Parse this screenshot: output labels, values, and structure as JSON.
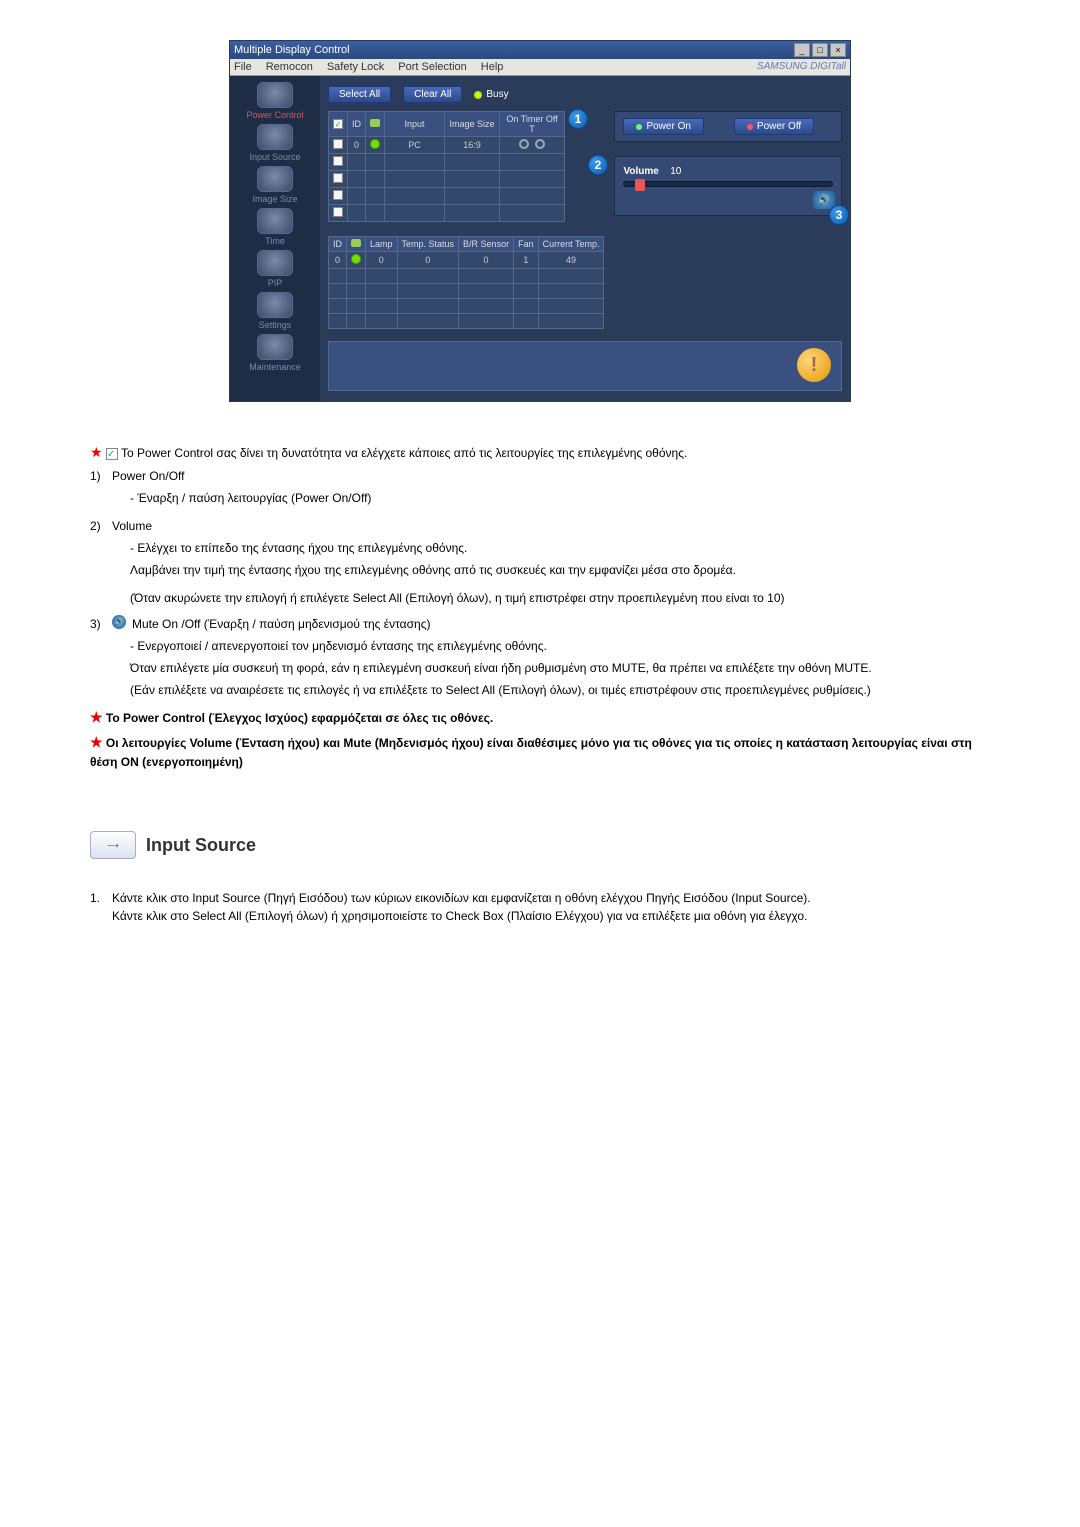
{
  "app": {
    "title": "Multiple Display Control",
    "menus": {
      "file": "File",
      "remocon": "Remocon",
      "safety": "Safety Lock",
      "port": "Port Selection",
      "help": "Help"
    },
    "brand": "SAMSUNG DIGITall",
    "sidebar": {
      "power": "Power Control",
      "input": "Input Source",
      "image": "Image Size",
      "time": "Time",
      "pip": "PIP",
      "settings": "Settings",
      "maint": "Maintenance"
    },
    "buttons": {
      "select_all": "Select All",
      "clear_all": "Clear All",
      "busy": "Busy"
    },
    "table1": {
      "hdr": {
        "id": "ID",
        "status": "",
        "input": "Input",
        "imgsize": "Image Size",
        "ontimer": "On Timer Off T"
      },
      "row0": {
        "id": "0",
        "input": "PC",
        "imgsize": "16:9"
      }
    },
    "table2": {
      "hdr": {
        "id": "ID",
        "status": "",
        "lamp": "Lamp",
        "temp": "Temp. Status",
        "br": "B/R Sensor",
        "fan": "Fan",
        "ctemp": "Current Temp."
      },
      "row0": {
        "id": "0",
        "lamp": "0",
        "temp": "0",
        "br": "0",
        "fan": "1",
        "ctemp": "49"
      }
    },
    "power": {
      "on": "Power On",
      "off": "Power Off"
    },
    "volume": {
      "label": "Volume",
      "value": "10"
    },
    "callouts": {
      "c1": "1",
      "c2": "2",
      "c3": "3"
    },
    "info": "!"
  },
  "doc": {
    "lead": "Το Power Control σας δίνει τη δυνατότητα να ελέγχετε κάποιες από τις λειτουργίες της επιλεγμένης οθόνης.",
    "p1_num": "1)",
    "p1_title": "Power On/Off",
    "p1_a": "- Έναρξη / παύση λειτουργίας (Power On/Off)",
    "p2_num": "2)",
    "p2_title": "Volume",
    "p2_a": "- Ελέγχει το επίπεδο της έντασης ήχου της επιλεγμένης οθόνης.",
    "p2_b": "Λαμβάνει την τιμή της έντασης ήχου της επιλεγμένης οθόνης από τις συσκευές και την εμφανίζει μέσα στο δρομέα.",
    "p2_c": "(Όταν ακυρώνετε την επιλογή ή επιλέγετε Select All (Επιλογή όλων), η τιμή επιστρέφει στην προεπιλεγμένη που είναι το 10)",
    "p3_num": "3)",
    "p3_title": "Mute On /Off (Έναρξη / παύση μηδενισμού της έντασης)",
    "p3_a": "- Ενεργοποιεί / απενεργοποιεί τον μηδενισμό έντασης της επιλεγμένης οθόνης.",
    "p3_b": "Όταν επιλέγετε μία συσκευή τη φορά, εάν η επιλεγμένη συσκευή είναι ήδη ρυθμισμένη στο MUTE, θα πρέπει να επιλέξετε την οθόνη MUTE.",
    "p3_c": "(Εάν επιλέξετε να αναιρέσετε τις επιλογές ή να επιλέξετε το Select All (Επιλογή όλων), οι τιμές επιστρέφουν στις προεπιλεγμένες ρυθμίσεις.)",
    "note1": "Το Power Control (Έλεγχος Ισχύος) εφαρμόζεται σε όλες τις οθόνες.",
    "note2": "Οι λειτουργίες Volume (Ένταση ήχου) και Mute (Μηδενισμός ήχου) είναι διαθέσιμες μόνο για τις οθόνες για τις οποίες η κατάσταση λειτουργίας είναι στη θέση ON (ενεργοποιημένη)",
    "section_title": "Input Source",
    "ol1_num": "1.",
    "ol1": "Κάντε κλικ στο Input Source (Πηγή Εισόδου) των κύριων εικονιδίων και εμφανίζεται η οθόνη ελέγχου Πηγής Εισόδου (Input Source).",
    "ol1b": "Κάντε κλικ στο Select All (Επιλογή όλων) ή χρησιμοποιείστε το Check Box (Πλαίσιο Ελέγχου) για να επιλέξετε μια οθόνη για έλεγχο."
  }
}
